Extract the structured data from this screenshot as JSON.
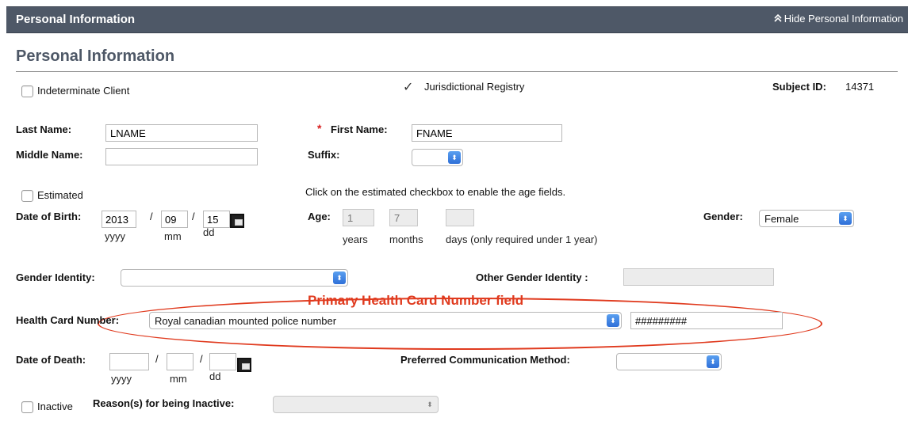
{
  "header": {
    "title": "Personal Information",
    "toggle_label": "Hide Personal Information"
  },
  "section_title": "Personal Information",
  "indeterminate_label": "Indeterminate Client",
  "jurisdictional": {
    "check": "✓",
    "label": "Jurisdictional Registry"
  },
  "subject": {
    "label": "Subject ID:",
    "value": "14371"
  },
  "last_name": {
    "label": "Last Name:",
    "value": "LNAME"
  },
  "first_name": {
    "required": "*",
    "label": "First Name:",
    "value": "FNAME"
  },
  "middle_name": {
    "label": "Middle Name:",
    "value": ""
  },
  "suffix": {
    "label": "Suffix:",
    "value": ""
  },
  "estimated": {
    "label": "Estimated",
    "hint": "Click on the estimated checkbox to enable the age fields."
  },
  "dob": {
    "label": "Date of Birth:",
    "yyyy": "2013",
    "mm": "09",
    "dd": "15",
    "sep": "/",
    "yyyy_hint": "yyyy",
    "mm_hint": "mm",
    "dd_hint": "dd"
  },
  "age": {
    "label": "Age:",
    "years": "1",
    "months": "7",
    "days": "",
    "years_hint": "years",
    "months_hint": "months",
    "days_hint": "days (only required under 1 year)"
  },
  "gender": {
    "label": "Gender:",
    "value": "Female"
  },
  "gender_identity": {
    "label": "Gender Identity:",
    "value": ""
  },
  "other_gender_identity": {
    "label": "Other Gender Identity :",
    "value": ""
  },
  "annotation": "Primary Health Card Number field",
  "health_card": {
    "label": "Health Card Number:",
    "type": "Royal canadian mounted police number",
    "number": "#########"
  },
  "dod": {
    "label": "Date of Death:",
    "yyyy": "",
    "mm": "",
    "dd": "",
    "sep": "/",
    "yyyy_hint": "yyyy",
    "mm_hint": "mm",
    "dd_hint": "dd"
  },
  "preferred_comm": {
    "label": "Preferred Communication Method:",
    "value": ""
  },
  "inactive": {
    "label": "Inactive",
    "reason_label": "Reason(s) for being Inactive:",
    "reason_value": ""
  },
  "icons": {
    "toggle": "double-chevron-up-icon",
    "select": "select-arrows-icon",
    "calendar": "calendar-icon"
  },
  "colors": {
    "header_bg": "#4e5867",
    "annotation": "#e03a1e",
    "required": "#d81f1f"
  }
}
